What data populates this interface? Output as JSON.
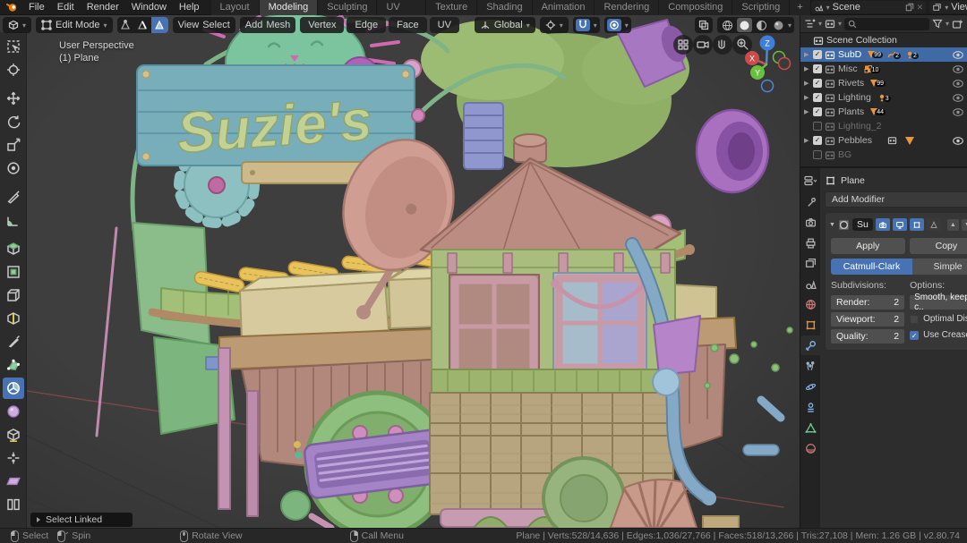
{
  "topbar": {
    "menus": [
      "File",
      "Edit",
      "Render",
      "Window",
      "Help"
    ],
    "tabs": [
      "Layout",
      "Modeling",
      "Sculpting",
      "UV Editing",
      "Texture Paint",
      "Shading",
      "Animation",
      "Rendering",
      "Compositing",
      "Scripting"
    ],
    "add_tab": "+",
    "scene_label": "Scene",
    "view_layer_label": "View Layer"
  },
  "viewport_header": {
    "mode": "Edit Mode",
    "menu_view": "View",
    "menu_select": "Select",
    "menu_add": "Add",
    "menu_mesh": "Mesh",
    "btn_vertex": "Vertex",
    "btn_edge": "Edge",
    "btn_face": "Face",
    "btn_uv": "UV",
    "orientation": "Global"
  },
  "toolbar": {
    "tools": [
      "select-box",
      "cursor",
      "move",
      "rotate",
      "scale",
      "transform",
      "annotate",
      "measure",
      "extrude-region",
      "inset-faces",
      "bevel",
      "loop-cut",
      "knife",
      "poly-build",
      "spin",
      "smooth",
      "edge-slide",
      "shrink-fatten",
      "shear",
      "rip-region"
    ],
    "active_tool": "spin"
  },
  "viewport": {
    "overlay_line1": "User Perspective",
    "overlay_line2": "(1) Plane",
    "sign_text": "Suzie's",
    "select_linked": "Select Linked",
    "gizmo_x": "X",
    "gizmo_y": "Y",
    "gizmo_z": "Z"
  },
  "outliner": {
    "root": "Scene Collection",
    "items": [
      {
        "label": "SubD",
        "checked": true,
        "selected": true,
        "eye": true,
        "badges": [
          {
            "icon": "mesh-data",
            "count": "99"
          },
          {
            "icon": "curve-data",
            "count": "2"
          },
          {
            "icon": "light-data",
            "count": "2"
          }
        ]
      },
      {
        "label": "Misc",
        "checked": true,
        "eye": true,
        "badges": [
          {
            "icon": "texture-data",
            "count": "10"
          }
        ]
      },
      {
        "label": "Rivets",
        "checked": true,
        "eye": true,
        "badges": [
          {
            "icon": "mesh-data",
            "count": "99"
          }
        ]
      },
      {
        "label": "Lighting",
        "checked": true,
        "eye": true,
        "badges": [
          {
            "icon": "light-data",
            "count": "3"
          }
        ]
      },
      {
        "label": "Plants",
        "checked": true,
        "eye": true,
        "badges": [
          {
            "icon": "mesh-data",
            "count": "44"
          }
        ]
      },
      {
        "label": "Lighting_2",
        "checked": false,
        "eye": false,
        "badges": []
      },
      {
        "label": "Pebbles",
        "checked": true,
        "eye": true,
        "badges": [
          {
            "icon": "collection"
          },
          {
            "icon": "object-data"
          }
        ]
      },
      {
        "label": "BG",
        "checked": false,
        "eye": false,
        "badges": []
      }
    ]
  },
  "properties": {
    "object_name": "Plane",
    "add_modifier_label": "Add Modifier",
    "modifier": {
      "name": "Su",
      "apply_label": "Apply",
      "copy_label": "Copy",
      "subdiv_type_active": "Catmull-Clark",
      "subdiv_type_alt": "Simple",
      "subdivisions_label": "Subdivisions:",
      "options_label": "Options:",
      "render_label": "Render:",
      "render_value": "2",
      "viewport_label": "Viewport:",
      "viewport_value": "2",
      "quality_label": "Quality:",
      "quality_value": "2",
      "uv_smooth_value": "Smooth, keep c..",
      "optimal_display_label": "Optimal Displ..",
      "use_creases_label": "Use Creases"
    }
  },
  "statusbar": {
    "hint_select": "Select",
    "hint_spin": "Spin",
    "hint_rotate": "Rotate View",
    "hint_menu": "Call Menu",
    "stats": "Plane | Verts:528/14,636 | Edges:1,036/27,766 | Faces:518/13,266 | Tris:27,108 | Mem: 1.26 GB | v2.80.74"
  },
  "colors": {
    "accent": "#4772b3",
    "selection_blue": "#3f6aa5",
    "badge_orange": "#e8953f",
    "viewport_bg": "#3b3b3b"
  }
}
